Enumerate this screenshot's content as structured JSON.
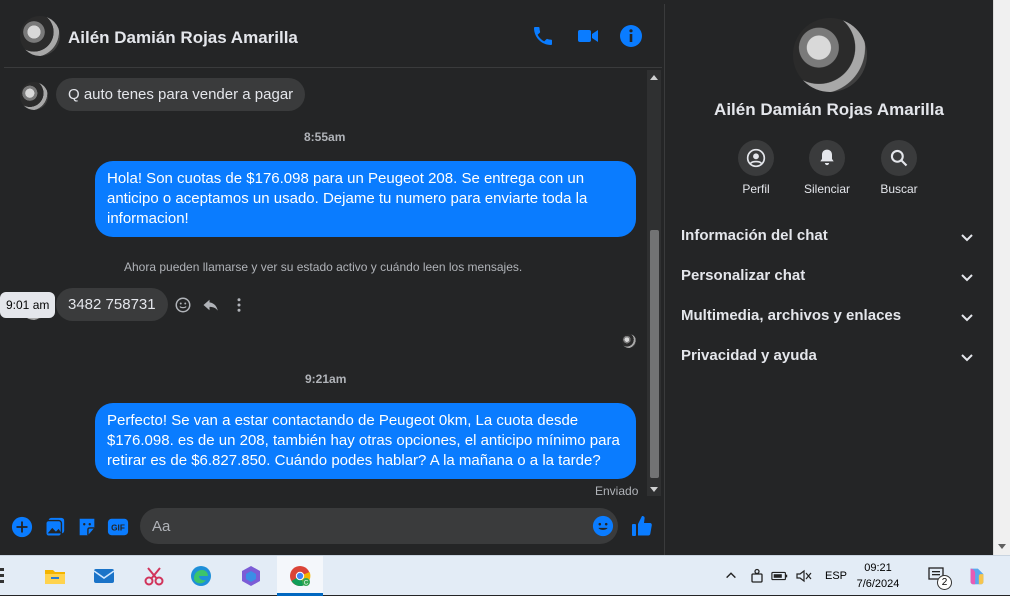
{
  "header": {
    "contact_name": "Ailén Damián Rojas Amarilla"
  },
  "messages": {
    "incoming_1": "Q auto tenes para vender a pagar",
    "timestamp_1": "8:55am",
    "outgoing_1": "Hola! Son cuotas de $176.098 para un Peugeot 208. Se entrega con un anticipo o aceptamos un usado. Dejame tu numero para enviarte toda la informacion!",
    "system_notice": "Ahora pueden llamarse y ver su estado activo y cuándo leen los mensajes.",
    "tooltip_time": "9:01 am",
    "incoming_2": "3482 758731",
    "timestamp_2": "9:21am",
    "outgoing_2": "Perfecto!  Se van a estar contactando de Peugeot 0km, La cuota desde $176.098. es de un 208, también hay otras opciones, el anticipo mínimo para retirar es de $6.827.850. Cuándo podes hablar? A la mañana o a la tarde?",
    "status": "Enviado"
  },
  "composer": {
    "placeholder": "Aa"
  },
  "sidebar": {
    "contact_name": "Ailén Damián Rojas Amarilla",
    "actions": [
      {
        "label": "Perfil",
        "icon": "profile-icon"
      },
      {
        "label": "Silenciar",
        "icon": "bell-icon"
      },
      {
        "label": "Buscar",
        "icon": "search-icon"
      }
    ],
    "sections": [
      "Información del chat",
      "Personalizar chat",
      "Multimedia, archivos y enlaces",
      "Privacidad y ayuda"
    ]
  },
  "taskbar": {
    "language": "ESP",
    "time": "09:21",
    "date": "7/6/2024",
    "notification_count": "2"
  },
  "colors": {
    "accent": "#0a7cff",
    "background": "#242526",
    "bubble_in": "#3a3b3c"
  }
}
